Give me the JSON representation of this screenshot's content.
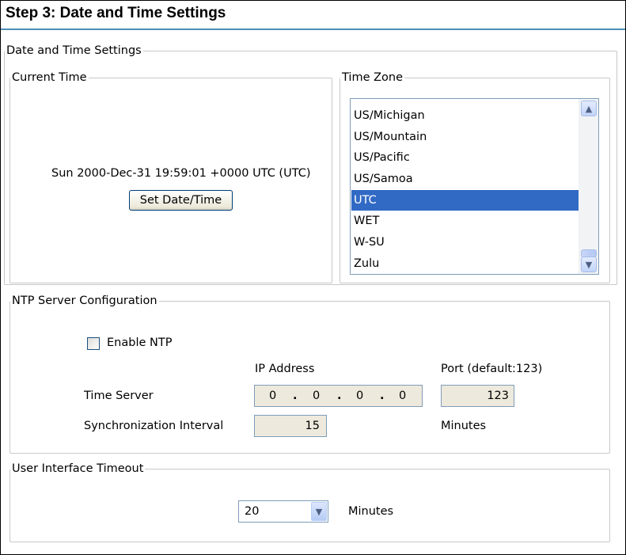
{
  "page": {
    "title": "Step 3: Date and Time Settings"
  },
  "datetime": {
    "legend": "Date and Time Settings",
    "current_time": {
      "legend": "Current Time",
      "value": "Sun 2000-Dec-31 19:59:01 +0000 UTC (UTC)",
      "button_label": "Set Date/Time"
    },
    "time_zone": {
      "legend": "Time Zone",
      "options": [
        "US/Michigan",
        "US/Mountain",
        "US/Pacific",
        "US/Samoa",
        "UTC",
        "WET",
        "W-SU",
        "Zulu"
      ],
      "selected": "UTC",
      "scroll_up_icon": "chevron-up-icon",
      "scroll_down_icon": "chevron-down-icon"
    }
  },
  "ntp": {
    "legend": "NTP Server Configuration",
    "enable_label": "Enable NTP",
    "enable_checked": false,
    "ip_address_header": "IP Address",
    "port_header": "Port (default:123)",
    "time_server_label": "Time Server",
    "ip_octets": [
      "0",
      "0",
      "0",
      "0"
    ],
    "ip_separator": ".",
    "port_value": "123",
    "sync_interval_label": "Synchronization Interval",
    "sync_interval_value": "15",
    "sync_interval_unit": "Minutes"
  },
  "ui_timeout": {
    "legend": "User Interface Timeout",
    "value": "20",
    "unit": "Minutes",
    "dropdown_icon": "chevron-down-icon"
  },
  "colors": {
    "header_rule": "#4f8db5",
    "selection": "#316ac5",
    "disabled_input": "#ede9dc"
  }
}
